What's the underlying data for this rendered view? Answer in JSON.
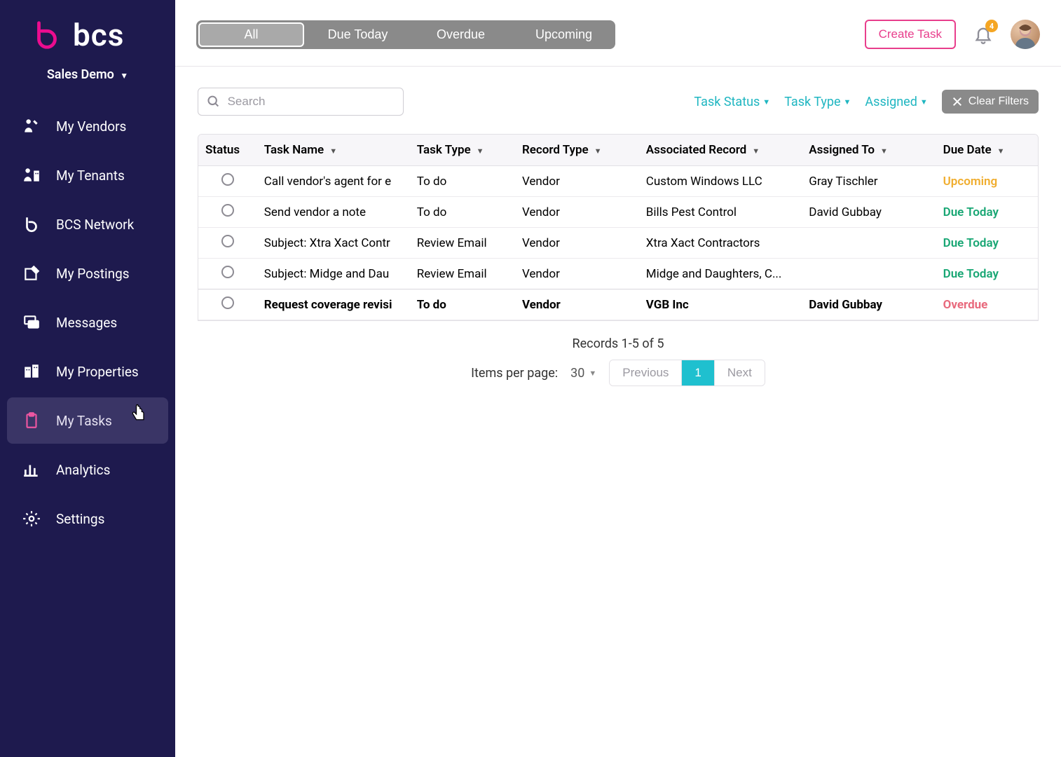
{
  "brand": {
    "name": "bcs"
  },
  "org": {
    "label": "Sales Demo"
  },
  "sidebar": {
    "items": [
      {
        "label": "My Vendors",
        "icon": "person-wrench-icon"
      },
      {
        "label": "My Tenants",
        "icon": "person-building-icon"
      },
      {
        "label": "BCS Network",
        "icon": "logo-mark-icon"
      },
      {
        "label": "My Postings",
        "icon": "pin-note-icon"
      },
      {
        "label": "Messages",
        "icon": "chat-icon"
      },
      {
        "label": "My Properties",
        "icon": "buildings-icon"
      },
      {
        "label": "My Tasks",
        "icon": "clipboard-icon",
        "active": true
      },
      {
        "label": "Analytics",
        "icon": "bar-chart-icon"
      },
      {
        "label": "Settings",
        "icon": "gear-icon"
      }
    ]
  },
  "tabs": {
    "items": [
      "All",
      "Due Today",
      "Overdue",
      "Upcoming"
    ],
    "active": 0
  },
  "actions": {
    "create_task": "Create Task",
    "notification_count": "4"
  },
  "search": {
    "placeholder": "Search"
  },
  "filters": {
    "task_status": "Task Status",
    "task_type": "Task Type",
    "assigned": "Assigned",
    "clear": "Clear Filters"
  },
  "table": {
    "columns": {
      "status": "Status",
      "task_name": "Task Name",
      "task_type": "Task Type",
      "record_type": "Record Type",
      "associated_record": "Associated Record",
      "assigned_to": "Assigned To",
      "due_date": "Due Date"
    },
    "rows": [
      {
        "name": "Call vendor's agent for e",
        "type": "To do",
        "record_type": "Vendor",
        "record": "Custom Windows LLC",
        "assigned": "Gray Tischler",
        "due": "Upcoming",
        "due_class": "upcoming"
      },
      {
        "name": "Send vendor a note",
        "type": "To do",
        "record_type": "Vendor",
        "record": "Bills Pest Control",
        "assigned": "David Gubbay",
        "due": "Due Today",
        "due_class": "today"
      },
      {
        "name": "Subject: Xtra Xact Contr",
        "type": "Review Email",
        "record_type": "Vendor",
        "record": "Xtra Xact Contractors",
        "assigned": "",
        "due": "Due Today",
        "due_class": "today"
      },
      {
        "name": "Subject: Midge and Dau",
        "type": "Review Email",
        "record_type": "Vendor",
        "record": "Midge and Daughters, C...",
        "assigned": "",
        "due": "Due Today",
        "due_class": "today"
      },
      {
        "name": "Request coverage revisi",
        "type": "To do",
        "record_type": "Vendor",
        "record": "VGB Inc",
        "assigned": "David Gubbay",
        "due": "Overdue",
        "due_class": "overdue",
        "bold": true
      }
    ]
  },
  "footer": {
    "records_text": "Records 1-5 of 5",
    "ipp_label": "Items per page:",
    "ipp_value": "30",
    "prev": "Previous",
    "page": "1",
    "next": "Next"
  }
}
